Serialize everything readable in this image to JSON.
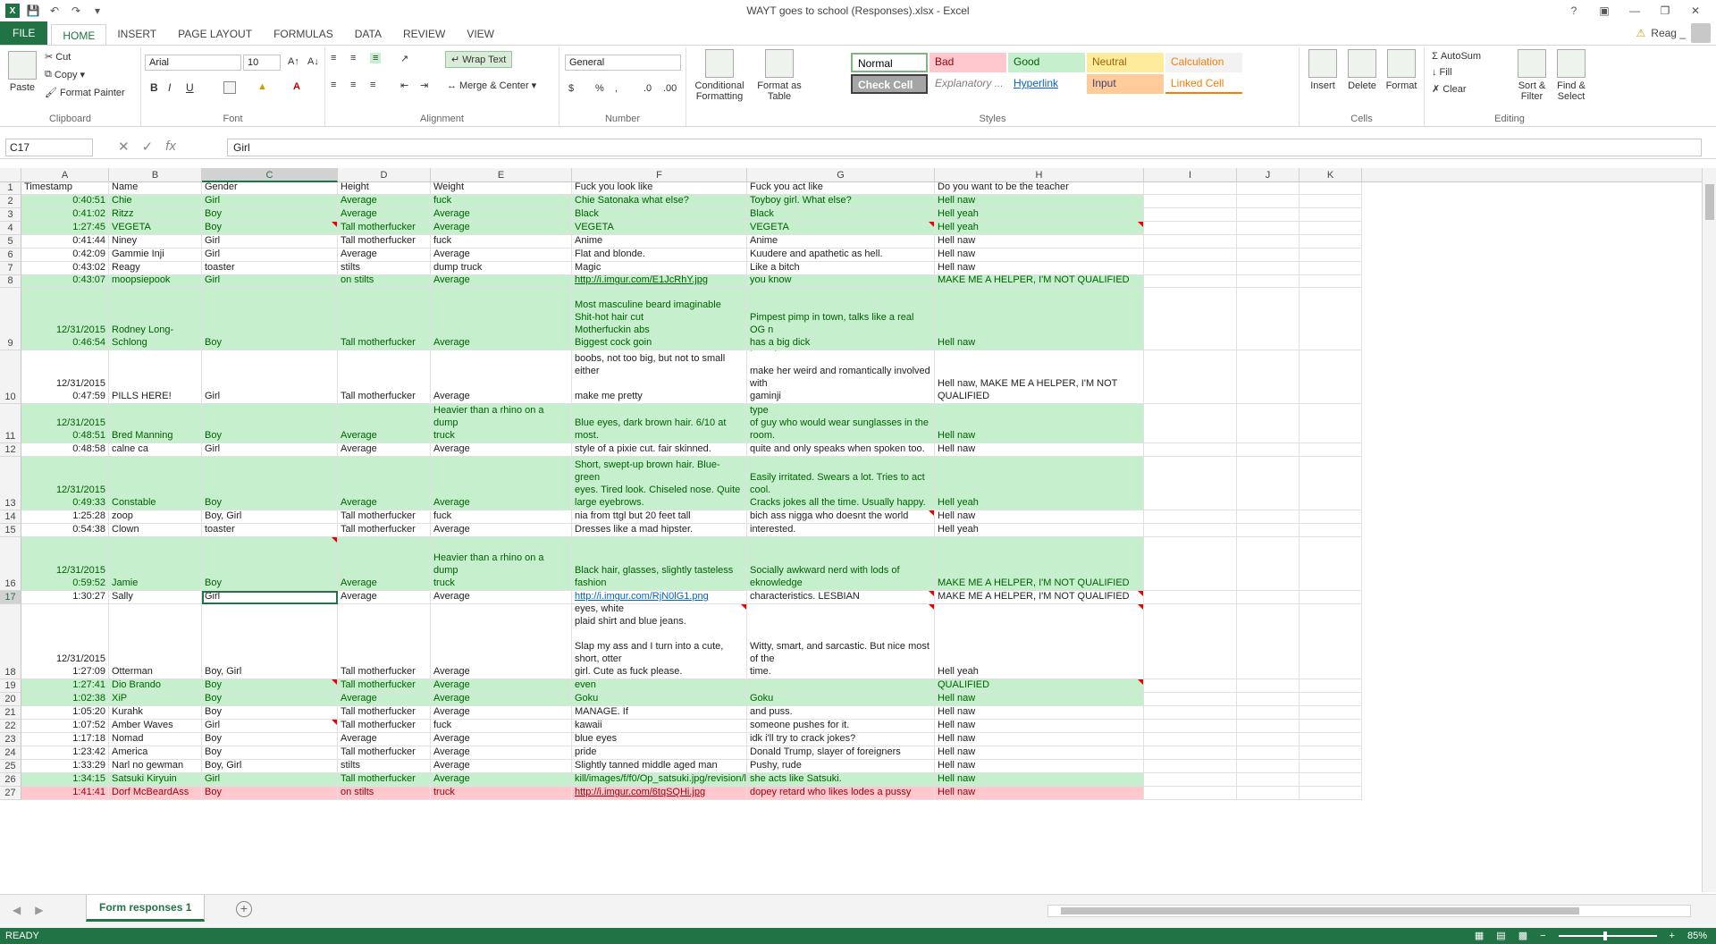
{
  "window": {
    "title": "WAYT goes to school (Responses).xlsx - Excel",
    "user": "Reag _"
  },
  "tabs": [
    "FILE",
    "HOME",
    "INSERT",
    "PAGE LAYOUT",
    "FORMULAS",
    "DATA",
    "REVIEW",
    "VIEW"
  ],
  "active_tab": "HOME",
  "ribbon": {
    "clipboard": {
      "label": "Clipboard",
      "paste": "Paste",
      "cut": "Cut",
      "copy": "Copy",
      "format_painter": "Format Painter"
    },
    "font": {
      "label": "Font",
      "name": "Arial",
      "size": "10",
      "bold": "B",
      "italic": "I",
      "underline": "U"
    },
    "alignment": {
      "label": "Alignment",
      "wrap_text": "Wrap Text",
      "merge_center": "Merge & Center"
    },
    "number": {
      "label": "Number",
      "format": "General",
      "currency": "$",
      "percent": "%",
      "comma": ","
    },
    "styles": {
      "label": "Styles",
      "conditional": "Conditional Formatting",
      "format_table": "Format as Table",
      "cells": [
        {
          "name": "Normal",
          "bg": "#ffffff",
          "fg": "#000000"
        },
        {
          "name": "Bad",
          "bg": "#ffc7ce",
          "fg": "#9c0006"
        },
        {
          "name": "Good",
          "bg": "#c6efce",
          "fg": "#006100"
        },
        {
          "name": "Neutral",
          "bg": "#ffeb9c",
          "fg": "#9c6500"
        },
        {
          "name": "Calculation",
          "bg": "#f2f2f2",
          "fg": "#fa7d00"
        },
        {
          "name": "Check Cell",
          "bg": "#a5a5a5",
          "fg": "#ffffff"
        },
        {
          "name": "Explanatory ...",
          "bg": "#ffffff",
          "fg": "#7f7f7f"
        },
        {
          "name": "Hyperlink",
          "bg": "#ffffff",
          "fg": "#0563c1"
        },
        {
          "name": "Input",
          "bg": "#ffcc99",
          "fg": "#3f3f76"
        },
        {
          "name": "Linked Cell",
          "bg": "#ffffff",
          "fg": "#fa7d00"
        }
      ]
    },
    "cells": {
      "label": "Cells",
      "insert": "Insert",
      "delete": "Delete",
      "format": "Format"
    },
    "editing": {
      "label": "Editing",
      "autosum": "AutoSum",
      "fill": "Fill",
      "clear": "Clear",
      "sort": "Sort & Filter",
      "find": "Find & Select"
    }
  },
  "formula_bar": {
    "name_box": "C17",
    "content": "Girl"
  },
  "columns": [
    "A",
    "B",
    "C",
    "D",
    "E",
    "F",
    "G",
    "H",
    "I",
    "J",
    "K"
  ],
  "selected_column": "C",
  "rows": [
    {
      "n": "1",
      "style": "",
      "cells": [
        "Timestamp",
        "Name",
        "Gender",
        "Height",
        "Weight",
        "Fuck you look like",
        "Fuck you act like",
        "Do you want to be the teacher"
      ]
    },
    {
      "n": "2",
      "style": "green",
      "cells": [
        "12/31/2015 0:40:51",
        "Chie",
        "Girl",
        "Average",
        "Go eat a sandwich you lanky fuck",
        "Chie Satonaka what else?",
        "Toyboy girl. What else?",
        "Hell naw"
      ]
    },
    {
      "n": "3",
      "style": "green",
      "cells": [
        "12/31/2015 0:41:02",
        "Ritzz",
        "Boy",
        "Average",
        "Average",
        "Black",
        "Black",
        "Hell yeah"
      ]
    },
    {
      "n": "4",
      "style": "green",
      "cells": [
        "12/31/2015 1:27:45",
        "VEGETA",
        "Boy",
        "Tall motherfucker",
        "Average",
        "VEGETA",
        "VEGETA",
        "Hell yeah"
      ]
    },
    {
      "n": "5",
      "style": "",
      "cells": [
        "12/31/2015 0:41:44",
        "Niney",
        "Girl",
        "Tall motherfucker",
        "Go eat a sandwich you lanky fuck",
        "Anime",
        "Anime",
        "Hell naw"
      ]
    },
    {
      "n": "6",
      "style": "",
      "cells": [
        "12/31/2015 0:42:09",
        "Gammie Inji",
        "Girl",
        "Average",
        "Average",
        "Flat and blonde.",
        "Kuudere and apathetic as hell.",
        "Hell naw"
      ]
    },
    {
      "n": "7",
      "style": "",
      "cells": [
        "12/31/2015 0:43:02",
        "Reagy",
        "I identify myself as rainbow toaster",
        "stilts",
        "Heavier than a rhino on a dump truck",
        "Magic",
        "Like a bitch",
        "Hell naw"
      ]
    },
    {
      "n": "8",
      "style": "green",
      "cells": [
        "12/31/2015 0:43:07",
        "moopsiepook",
        "Girl",
        "on stilts",
        "Average",
        "http://i.imgur.com/E1JcRhY.jpg",
        "you know",
        "MAKE ME A HELPER, I'M NOT QUALIFIED"
      ]
    },
    {
      "n": "9",
      "style": "green",
      "cells": [
        "12/31/2015 0:46:54",
        "Rodney Long-Schlong",
        "Boy",
        "Tall motherfucker",
        "Average",
        "Most masculine beard imaginable\nShit-hot hair cut\nMotherfuckin abs\nBiggest cock goin",
        "Pimpest pimp in town, talks like a real OG n\nhas a big dick",
        "Hell naw"
      ]
    },
    {
      "n": "10",
      "style": "",
      "cells": [
        "12/31/2015 0:47:59",
        "PILLS HERE!",
        "Girl",
        "Tall motherfucker",
        "Average",
        "brunette\nboobs, not too big, but not to small either\n\nmake me pretty",
        "pill is pill\n\nmake her weird and romantically involved with\ngaminji",
        "Hell naw, MAKE ME A HELPER, I'M NOT QUALIFIED"
      ]
    },
    {
      "n": "11",
      "style": "green",
      "cells": [
        "12/31/2015 0:48:51",
        "Bred Manning",
        "Boy",
        "Average",
        "Heavier than a rhino on a dump\ntruck",
        "Blue eyes, dark brown hair. 6/10 at most.",
        "Arrogant, self taught comedian. He's the type\nof guy who would wear sunglasses in the\nroom.",
        "Hell naw"
      ]
    },
    {
      "n": "12",
      "style": "",
      "cells": [
        "12/31/2015 0:48:58",
        "calne ca",
        "Girl",
        "Average",
        "Average",
        "style of a pixie cut. fair skinned.",
        "quite and only speaks when spoken too.",
        "Hell naw"
      ]
    },
    {
      "n": "13",
      "style": "green",
      "cells": [
        "12/31/2015 0:49:33",
        "Constable",
        "Boy",
        "Average",
        "Average",
        "Short, swept-up brown hair. Blue-green\neyes. Tired look. Chiseled nose. Quite\nlarge eyebrows.",
        "Easily irritated. Swears a lot. Tries to act cool.\nCracks jokes all the time. Usually happy.",
        "Hell yeah"
      ]
    },
    {
      "n": "14",
      "style": "",
      "cells": [
        "12/31/2015 1:25:28",
        "zoop",
        "Boy, Girl",
        "Tall motherfucker",
        "Go eat a sandwich you lanky fuck",
        "nia from ttgl but 20 feet tall",
        "bich ass nigga who doesnt the world",
        "Hell naw"
      ]
    },
    {
      "n": "15",
      "style": "",
      "cells": [
        "12/31/2015 0:54:38",
        "Clown",
        "I identify myself as rainbow toaster",
        "Tall motherfucker",
        "Average",
        "Dresses like a mad hipster.",
        "Tired, slow, somewhat but not really interested.",
        "Hell yeah"
      ]
    },
    {
      "n": "16",
      "style": "green",
      "cells": [
        "12/31/2015 0:59:52",
        "Jamie",
        "Boy",
        "Average",
        "Heavier than a rhino on a dump\ntruck",
        "Black hair, glasses, slightly tasteless\nfashion",
        "Socially awkward nerd with lods of\neknowledge",
        "MAKE ME A HELPER, I'M NOT QUALIFIED"
      ]
    },
    {
      "n": "17",
      "style": "",
      "cells": [
        "12/31/2015 1:30:27",
        "Sally",
        "Girl",
        "Average",
        "Average",
        "http://i.imgur.com/RjN0lG1.png",
        "characteristics. LESBIAN",
        "MAKE ME A HELPER, I'M NOT QUALIFIED"
      ]
    },
    {
      "n": "18",
      "style": "",
      "cells": [
        "12/31/2015 1:27:09",
        "Otterman",
        "Boy, Girl",
        "Tall motherfucker",
        "Average",
        "Wavy brown hair, glasses, brown eyes, white\nplaid shirt and blue jeans.\n\nSlap my ass and I turn into a cute, short, otter\ngirl. Cute as fuck please.",
        "Witty, smart, and sarcastic. But nice most of the\ntime.",
        "Hell yeah"
      ]
    },
    {
      "n": "19",
      "style": "green",
      "cells": [
        "12/31/2015 1:27:41",
        "Dio Brando",
        "Boy",
        "Tall motherfucker",
        "Average",
        "Phantom Blood Dio Brando, I'm not even",
        "",
        "QUALIFIED"
      ]
    },
    {
      "n": "20",
      "style": "green",
      "cells": [
        "12/31/2015 1:02:38",
        "XiP",
        "Boy",
        "Average",
        "Average",
        "Goku",
        "Goku",
        "Hell naw"
      ]
    },
    {
      "n": "21",
      "style": "",
      "cells": [
        "12/31/2015 1:05:20",
        "Kurahk",
        "Boy",
        "Tall motherfucker",
        "Average",
        "GODAMN VIKING BEARD YOU CAN MANAGE. If",
        "and puss.",
        "Hell naw"
      ]
    },
    {
      "n": "22",
      "style": "",
      "cells": [
        "12/31/2015 1:07:52",
        "Amber Waves",
        "Girl",
        "Tall motherfucker",
        "Go eat a sandwich you lanky fuck",
        "Like Julianne Moore, but teenage and kawaii",
        "someone pushes for it.",
        "Hell naw"
      ]
    },
    {
      "n": "23",
      "style": "",
      "cells": [
        "12/31/2015 1:17:18",
        "Nomad",
        "Boy",
        "Average",
        "Average",
        "blue eyes",
        "idk i'll try to crack jokes?",
        "Hell naw"
      ]
    },
    {
      "n": "24",
      "style": "",
      "cells": [
        "12/31/2015 1:23:42",
        "America",
        "Boy",
        "Tall motherfucker",
        "Average",
        "Donald Trump, epitome of american pride",
        "Donald Trump, slayer of foreigners",
        "Hell naw"
      ]
    },
    {
      "n": "25",
      "style": "",
      "cells": [
        "12/31/2015 1:33:29",
        "Narl no gewman",
        "Boy, Girl",
        "stilts",
        "Average",
        "Slightly tanned middle aged man",
        "Pushy, rude",
        "Hell naw"
      ]
    },
    {
      "n": "26",
      "style": "green",
      "cells": [
        "12/31/2015 1:34:15",
        "Satsuki Kiryuin",
        "Girl",
        "Tall motherfucker",
        "Average",
        "kill/images/f/f0/Op_satsuki.jpg/revision/l",
        "she acts like Satsuki.",
        "Hell naw"
      ]
    },
    {
      "n": "27",
      "style": "red",
      "cells": [
        "12/31/2015 1:41:41",
        "Dorf McBeardAss",
        "Boy",
        "on stilts",
        "truck",
        "http://i.imgur.com/6tqSQHi.jpg",
        "dopey retard who likes lodes a pussy",
        "Hell naw"
      ]
    }
  ],
  "sheet": {
    "name": "Form responses 1"
  },
  "status": {
    "mode": "READY",
    "zoom": "85%"
  }
}
